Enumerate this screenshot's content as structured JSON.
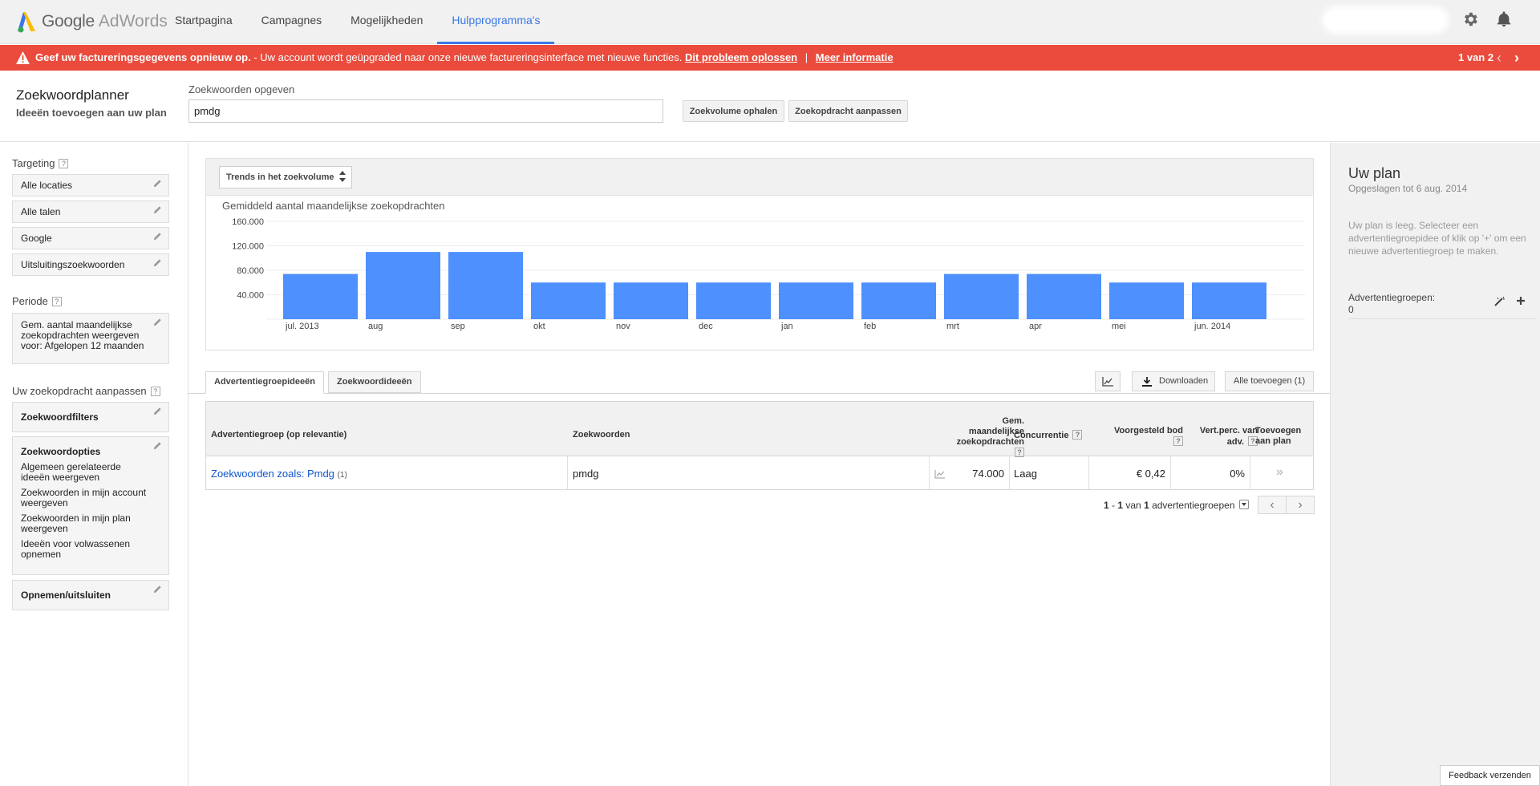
{
  "logo": {
    "google": "Google",
    "adwords": "AdWords"
  },
  "nav": {
    "items": [
      {
        "label": "Startpagina"
      },
      {
        "label": "Campagnes"
      },
      {
        "label": "Mogelijkheden"
      },
      {
        "label": "Hulpprogramma's",
        "active": true
      }
    ]
  },
  "alert": {
    "bold_text": "Geef uw factureringsgegevens opnieuw op.",
    "text": " - Uw account wordt geüpgraded naar onze nieuwe factureringsinterface met nieuwe functies.",
    "fix_link": "Dit probleem oplossen",
    "separator": "|",
    "more_link": "Meer informatie",
    "count": "1 van 2",
    "prev": "‹",
    "next": "›"
  },
  "planner": {
    "title": "Zoekwoordplanner",
    "subtitle": "Ideeën toevoegen aan uw plan",
    "keyword_label": "Zoekwoorden opgeven",
    "keyword_value": "pmdg",
    "btn_volume": "Zoekvolume ophalen",
    "btn_adjust": "Zoekopdracht aanpassen"
  },
  "sidebar": {
    "targeting_heading": "Targeting",
    "help": "?",
    "targeting": [
      "Alle locaties",
      "Alle talen",
      "Google",
      "Uitsluitingszoekwoorden"
    ],
    "period_heading": "Periode",
    "period_text": "Gem. aantal maandelijkse zoekopdrachten weergeven voor: Afgelopen 12 maanden",
    "adjust_heading": "Uw zoekopdracht aanpassen",
    "filters": "Zoekwoordfilters",
    "options_title": "Zoekwoordopties",
    "options": [
      "Algemeen gerelateerde ideeën weergeven",
      "Zoekwoorden in mijn account weergeven",
      "Zoekwoorden in mijn plan weergeven",
      "Ideeën voor volwassenen opnemen"
    ],
    "include": "Opnemen/uitsluiten"
  },
  "chart_panel": {
    "dropdown": "Trends in het zoekvolume"
  },
  "chart_data": {
    "type": "bar",
    "title": "Gemiddeld aantal maandelijkse zoekopdrachten",
    "categories": [
      "jul. 2013",
      "aug",
      "sep",
      "okt",
      "nov",
      "dec",
      "jan",
      "feb",
      "mrt",
      "apr",
      "mei",
      "jun. 2014"
    ],
    "values": [
      74000,
      110000,
      110000,
      60000,
      60000,
      60000,
      60000,
      60000,
      74000,
      74000,
      60000,
      60000
    ],
    "yticks": [
      {
        "value": 40000,
        "label": "40.000"
      },
      {
        "value": 80000,
        "label": "80.000"
      },
      {
        "value": 120000,
        "label": "120.000"
      },
      {
        "value": 160000,
        "label": "160.000"
      }
    ],
    "ylim": [
      0,
      160000
    ],
    "bar_color": "#4d90fe",
    "grid": true
  },
  "tabs": {
    "adgroup": "Advertentiegroepideeën",
    "keywords": "Zoekwoordideeën",
    "download": "Downloaden",
    "add_all": "Alle toevoegen (1)"
  },
  "table": {
    "headers": {
      "adgroup": "Advertentiegroep (op relevantie)",
      "keywords": "Zoekwoorden",
      "avg_l1": "Gem.",
      "avg_l2": "maandelijkse",
      "avg_l3": "zoekopdrachten",
      "competition": "Concurrentie",
      "bid": "Voorgesteld bod",
      "share_l1": "Vert.perc. van",
      "share_l2": "adv.",
      "add_l1": "Toevoegen",
      "add_l2": "aan plan"
    },
    "row": {
      "adgroup": "Zoekwoorden zoals: Pmdg",
      "adgroup_count": "(1)",
      "keywords": "pmdg",
      "avg": "74.000",
      "competition": "Laag",
      "bid": "€ 0,42",
      "share": "0%",
      "add": "»"
    }
  },
  "pager": {
    "range_start": "1",
    "dash": " - ",
    "range_end": "1",
    "of": " van ",
    "total": "1",
    "unit": " advertentiegroepen",
    "prev": "‹",
    "next": "›"
  },
  "plan": {
    "title": "Uw plan",
    "saved": "Opgeslagen tot 6 aug. 2014",
    "empty": "Uw plan is leeg. Selecteer een advertentiegroepidee of klik op '+' om een nieuwe advertentiegroep te maken.",
    "groups_label": "Advertentiegroepen:",
    "groups_count": "0"
  },
  "feedback": "Feedback verzenden"
}
